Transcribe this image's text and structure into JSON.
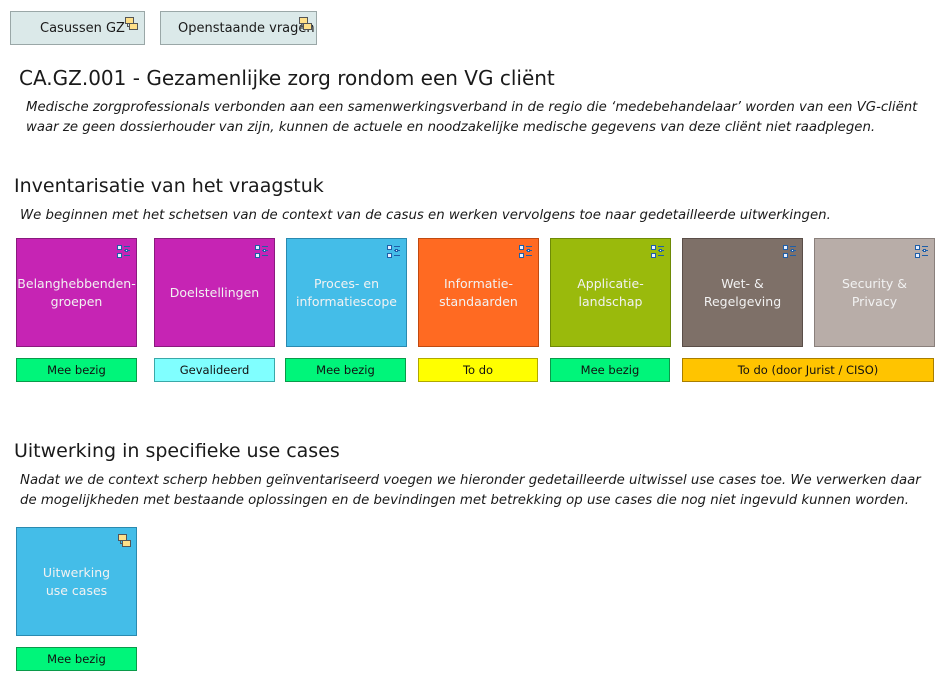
{
  "nav": {
    "buttons": [
      {
        "label": "Casussen GZ",
        "icon": "submodel-icon"
      },
      {
        "label": "Openstaande vragen",
        "icon": "submodel-icon"
      }
    ]
  },
  "header": {
    "title": "CA.GZ.001 - Gezamenlijke zorg rondom een VG cliënt",
    "description_line1": "Medische zorgprofessionals verbonden aan een samenwerkingsverband in de regio die ‘medebehandelaar’ worden van een VG-cliënt",
    "description_line2": "waar ze geen dossierhouder van zijn, kunnen de actuele en noodzakelijke medische gegevens van deze cliënt niet raadplegen."
  },
  "inventarisatie": {
    "heading": "Inventarisatie van het vraagstuk",
    "description": "We beginnen met het schetsen van de context van de casus en werken vervolgens toe naar gedetailleerde uitwerkingen.",
    "tiles": [
      {
        "label": "Belanghebbenden-\ngroepen",
        "color": "#c624b4",
        "border": "#8a1a7e",
        "icon": "list-view-icon"
      },
      {
        "label": "Doelstellingen",
        "color": "#c624b4",
        "border": "#8a1a7e",
        "icon": "list-view-icon"
      },
      {
        "label": "Proces- en\ninformatiescope",
        "color": "#44bde8",
        "border": "#2a8ab0",
        "icon": "list-view-icon"
      },
      {
        "label": "Informatie-\nstandaarden",
        "color": "#ff6a22",
        "border": "#c04a10",
        "icon": "list-view-icon"
      },
      {
        "label": "Applicatie-\nlandschap",
        "color": "#9aba0c",
        "border": "#6e8a06",
        "icon": "list-view-icon"
      },
      {
        "label": "Wet- &\nRegelgeving",
        "color": "#7e7068",
        "border": "#5a4e48",
        "icon": "list-view-icon"
      },
      {
        "label": "Security & Privacy",
        "color": "#b8ada8",
        "border": "#8a807c",
        "icon": "list-view-icon"
      }
    ],
    "statuses": [
      {
        "label": "Mee bezig",
        "color": "#00f57a",
        "border": "#0a9a4a"
      },
      {
        "label": "Gevalideerd",
        "color": "#80ffff",
        "border": "#3aa8a8"
      },
      {
        "label": "Mee bezig",
        "color": "#00f57a",
        "border": "#0a9a4a"
      },
      {
        "label": "To do",
        "color": "#ffff00",
        "border": "#b0a800"
      },
      {
        "label": "Mee bezig",
        "color": "#00f57a",
        "border": "#0a9a4a"
      },
      {
        "label": "To do (door Jurist / CISO)",
        "color": "#ffc400",
        "border": "#a87e00"
      }
    ]
  },
  "uitwerking": {
    "heading": "Uitwerking in specifieke use cases",
    "description_line1": "Nadat we de context scherp hebben geïnventariseerd voegen we hieronder gedetailleerde uitwissel use cases toe. We verwerken daar",
    "description_line2": "de mogelijkheden met bestaande oplossingen en de bevindingen met betrekking op use cases die nog niet ingevuld kunnen worden.",
    "tile": {
      "label": "Uitwerking\nuse cases",
      "color": "#44bde8",
      "border": "#2a8ab0",
      "icon": "submodel-icon"
    },
    "status": {
      "label": "Mee bezig",
      "color": "#00f57a",
      "border": "#0a9a4a"
    }
  }
}
